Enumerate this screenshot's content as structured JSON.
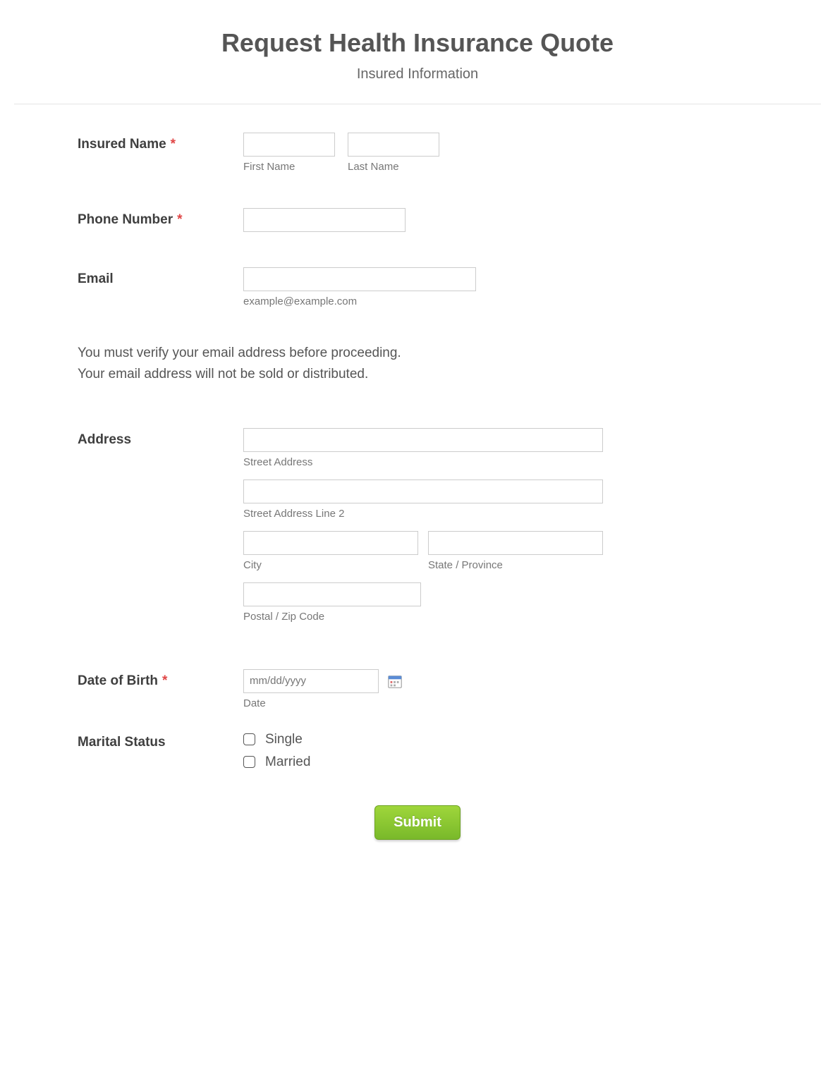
{
  "header": {
    "title": "Request Health Insurance Quote",
    "subtitle": "Insured Information"
  },
  "fields": {
    "insuredName": {
      "label": "Insured Name",
      "required": "*",
      "firstName": {
        "value": "",
        "sublabel": "First Name"
      },
      "lastName": {
        "value": "",
        "sublabel": "Last Name"
      }
    },
    "phone": {
      "label": "Phone Number",
      "required": "*",
      "value": ""
    },
    "email": {
      "label": "Email",
      "value": "",
      "sublabel": "example@example.com"
    },
    "info": {
      "line1": "You must verify your email address before proceeding.",
      "line2": "Your email address will not be sold or distributed."
    },
    "address": {
      "label": "Address",
      "street1": {
        "value": "",
        "sublabel": "Street Address"
      },
      "street2": {
        "value": "",
        "sublabel": "Street Address Line 2"
      },
      "city": {
        "value": "",
        "sublabel": "City"
      },
      "state": {
        "value": "",
        "sublabel": "State / Province"
      },
      "zip": {
        "value": "",
        "sublabel": "Postal / Zip Code"
      }
    },
    "dob": {
      "label": "Date of Birth",
      "required": "*",
      "placeholder": "mm/dd/yyyy",
      "value": "",
      "sublabel": "Date"
    },
    "maritalStatus": {
      "label": "Marital Status",
      "options": [
        "Single",
        "Married"
      ]
    }
  },
  "submit": {
    "label": "Submit"
  }
}
